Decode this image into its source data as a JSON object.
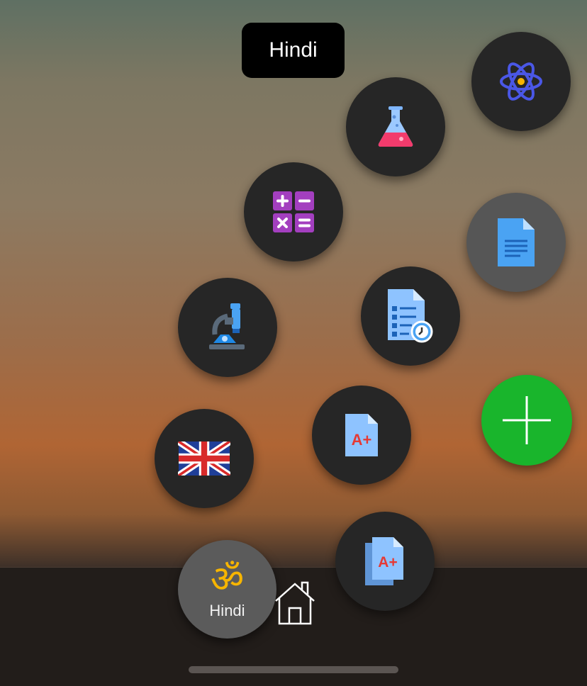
{
  "tooltip": {
    "text": "Hindi"
  },
  "menu_items": [
    {
      "id": "physics",
      "icon": "atom-icon"
    },
    {
      "id": "chemistry",
      "icon": "flask-icon"
    },
    {
      "id": "maths",
      "icon": "calculator-icon"
    },
    {
      "id": "document",
      "icon": "document-icon"
    },
    {
      "id": "biology",
      "icon": "microscope-icon"
    },
    {
      "id": "test",
      "icon": "checklist-timer-icon"
    },
    {
      "id": "english",
      "icon": "uk-flag-icon"
    },
    {
      "id": "grade",
      "icon": "a-plus-document-icon"
    },
    {
      "id": "grades",
      "icon": "a-plus-documents-icon"
    }
  ],
  "add_button": {
    "icon": "plus-icon",
    "color": "#19b52c"
  },
  "current_subject": {
    "label": "Hindi",
    "icon": "om-icon",
    "icon_text": "ॐ"
  },
  "nav": {
    "home_icon": "home-icon"
  },
  "colors": {
    "accent_green": "#19b52c",
    "om_yellow": "#f7b500"
  }
}
